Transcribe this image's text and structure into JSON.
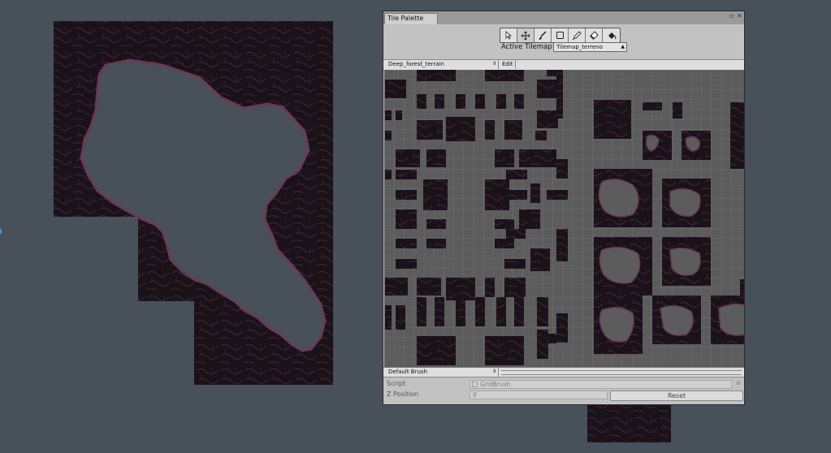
{
  "window": {
    "title": "Tile Palette",
    "active_tilemap_label": "Active Tilemap",
    "active_tilemap_value": "Tilemap_terreno",
    "palette_name": "Deep_forest_terrain",
    "edit_label": "Edit",
    "brush_name": "Default Brush",
    "script_label": "Script",
    "script_value": "GridBrush",
    "z_position_label": "Z Position",
    "z_position_value": "0",
    "reset_label": "Reset"
  },
  "tools": [
    "select-tool-icon",
    "move-tool-icon",
    "paint-brush-icon",
    "box-fill-icon",
    "eyedropper-icon",
    "eraser-icon",
    "flood-fill-icon"
  ],
  "colors": {
    "scene_background": "#48505a",
    "terrain_dark": "#1b1219",
    "terrain_edge": "#6a3a55",
    "grid_background": "#5c5c5c",
    "grid_line": "#727272"
  }
}
